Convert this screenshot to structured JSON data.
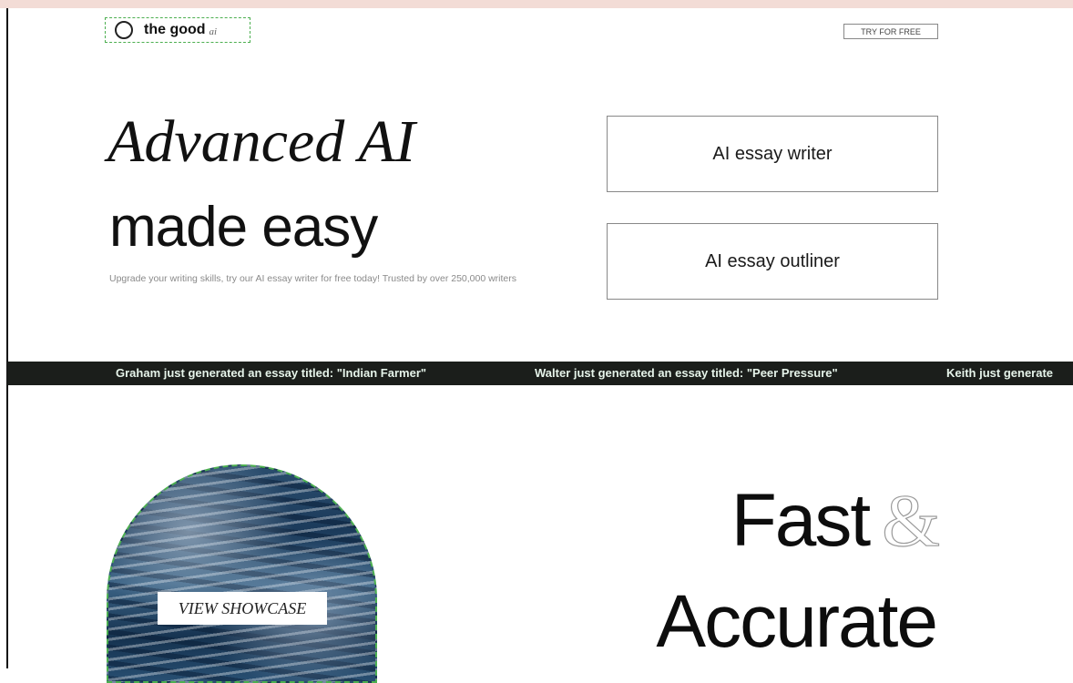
{
  "brand": {
    "name": "the good",
    "suffix": "ai"
  },
  "header": {
    "try_label": "TRY FOR FREE"
  },
  "hero": {
    "title_line1": "Advanced AI",
    "title_line2": "made easy",
    "subtitle": "Upgrade your writing skills, try our AI essay writer for free today! Trusted by over 250,000 writers"
  },
  "tools": [
    {
      "label": "AI essay writer"
    },
    {
      "label": "AI essay outliner"
    }
  ],
  "ticker": {
    "items": [
      "Graham just generated an essay titled: \"Indian Farmer\"",
      "Walter just generated an essay titled: \"Peer Pressure\"",
      "Keith just generate"
    ]
  },
  "showcase": {
    "button_label": "VIEW SHOWCASE"
  },
  "feature": {
    "line1_word": "Fast",
    "ampersand": "&",
    "line2": "Accurate"
  },
  "colors": {
    "ticker_bg": "#1b1e1b",
    "ticker_text": "#e6f4ea",
    "top_strip": "#f3dcd6"
  }
}
